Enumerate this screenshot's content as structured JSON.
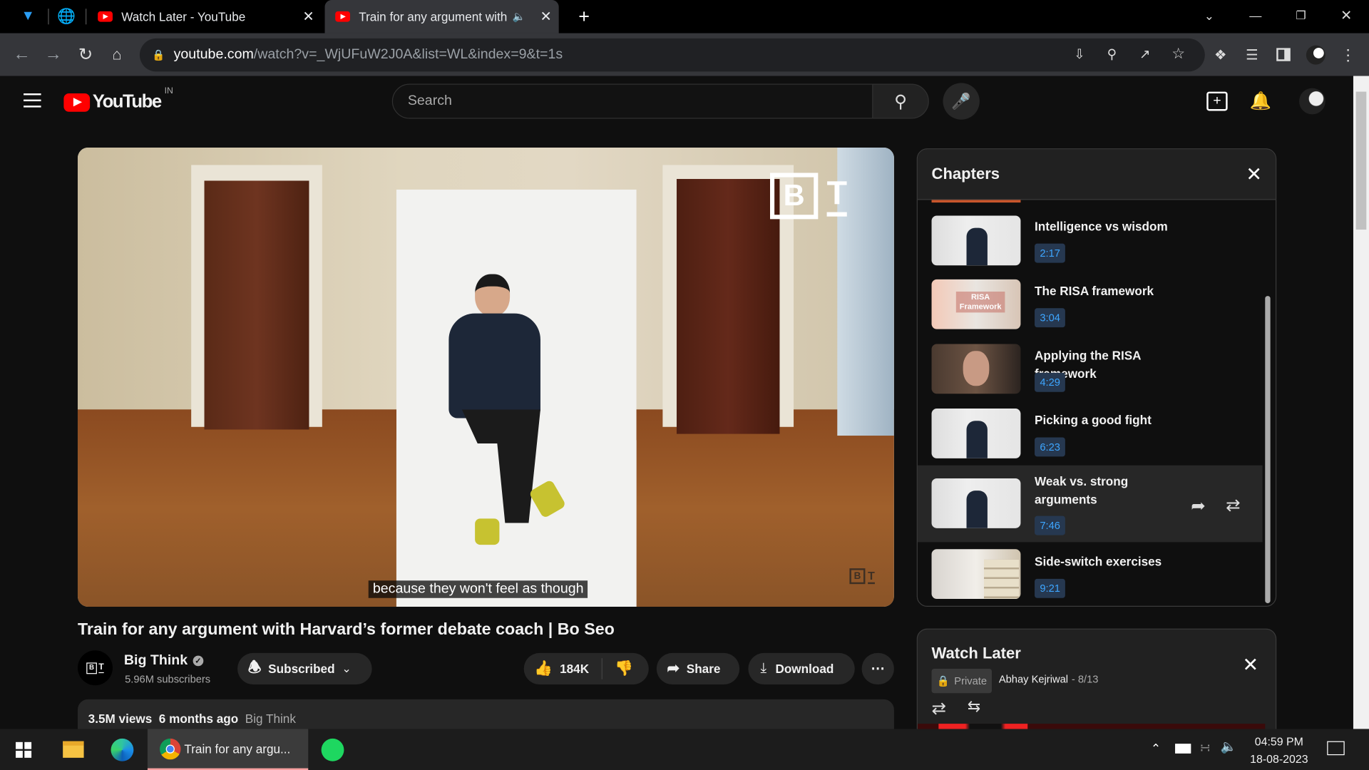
{
  "browser": {
    "tabs": [
      {
        "label": "Watch Later - YouTube"
      },
      {
        "label": "Train for any argument with H"
      }
    ],
    "url_domain": "youtube.com",
    "url_path": "/watch?v=_WjUFuW2J0A&list=WL&index=9&t=1s"
  },
  "youtube": {
    "logo_text": "YouTube",
    "region": "IN",
    "search_placeholder": "Search"
  },
  "video": {
    "caption": "because they won't feel as though",
    "title": "Train for any argument with Harvard’s former debate coach | Bo Seo",
    "channel": "Big Think",
    "subscribers": "5.96M subscribers",
    "subscribed_label": "Subscribed",
    "likes": "184K",
    "share_label": "Share",
    "download_label": "Download",
    "views": "3.5M views",
    "age": "6 months ago",
    "desc_channel": "Big Think",
    "watermark": "B T"
  },
  "chapters": {
    "title": "Chapters",
    "items": [
      {
        "title": "Intelligence vs wisdom",
        "time": "2:17"
      },
      {
        "title": "The RISA framework",
        "time": "3:04"
      },
      {
        "title": "Applying the RISA framework",
        "time": "4:29"
      },
      {
        "title": "Picking a good fight",
        "time": "6:23"
      },
      {
        "title": "Weak vs. strong arguments",
        "time": "7:46",
        "active": true
      },
      {
        "title": "Side-switch exercises",
        "time": "9:21"
      }
    ]
  },
  "watch_later": {
    "title": "Watch Later",
    "privacy": "Private",
    "owner": "Abhay Kejriwal",
    "position": "- 8/13"
  },
  "taskbar": {
    "chrome_label": "Train for any argu...",
    "time": "04:59 PM",
    "date": "18-08-2023"
  }
}
